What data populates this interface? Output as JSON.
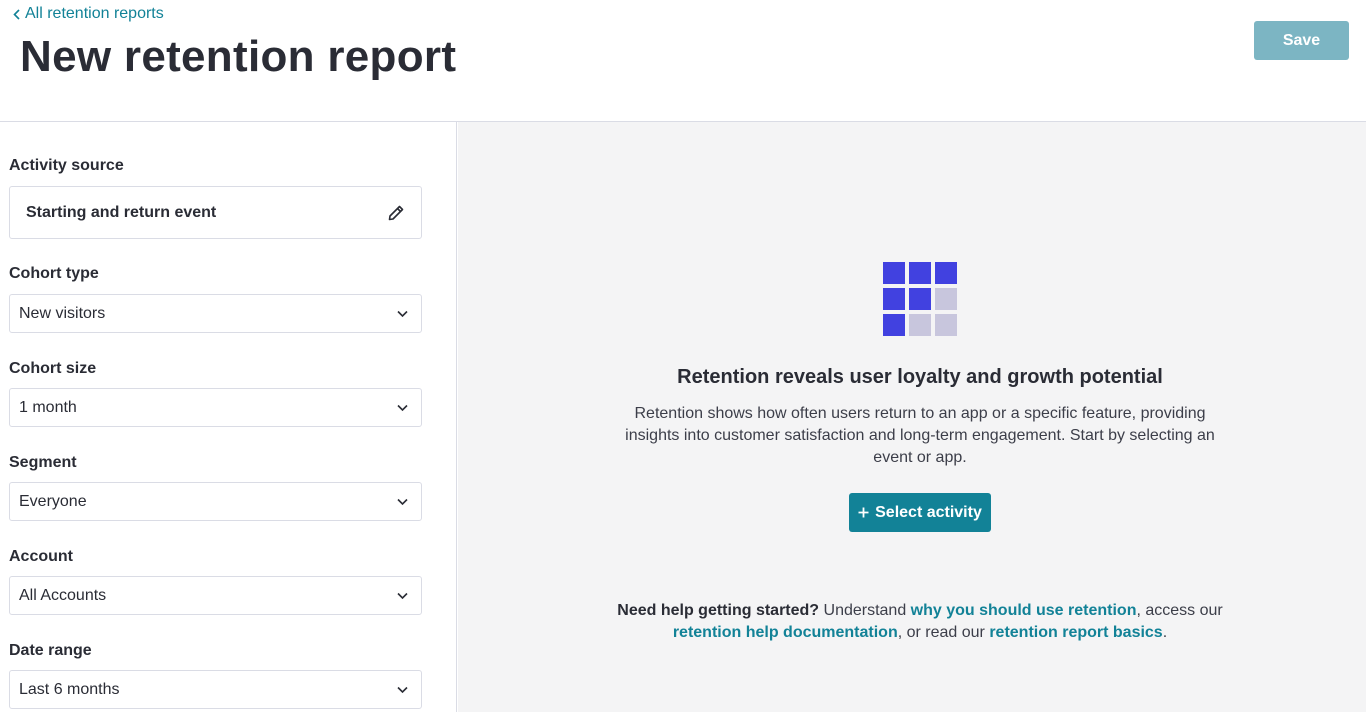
{
  "header": {
    "back_link": "All retention reports",
    "title": "New retention report",
    "save_label": "Save"
  },
  "sidebar": {
    "activity_source": {
      "label": "Activity source",
      "value": "Starting and return event"
    },
    "cohort_type": {
      "label": "Cohort type",
      "value": "New visitors"
    },
    "cohort_size": {
      "label": "Cohort size",
      "value": "1 month"
    },
    "segment": {
      "label": "Segment",
      "value": "Everyone"
    },
    "account": {
      "label": "Account",
      "value": "All Accounts"
    },
    "date_range": {
      "label": "Date range",
      "value": "Last 6 months"
    }
  },
  "main": {
    "empty_title": "Retention reveals user loyalty and growth potential",
    "empty_description": "Retention shows how often users return to an app or a specific feature, providing insights into customer satisfaction and long-term engagement. Start by selecting an event or app.",
    "select_activity_label": "Select activity",
    "help": {
      "lead": "Need help getting started?",
      "text1": " Understand ",
      "link1": "why you should use retention",
      "text2": ", access our ",
      "link2": "retention help documentation",
      "text3": ", or read our ",
      "link3": "retention report basics",
      "text4": "."
    }
  },
  "colors": {
    "accent": "#128297",
    "save_disabled": "#7cb5c3",
    "grid_active": "#4141e0",
    "grid_inactive": "#c8c6dd"
  },
  "icons": [
    "chevron-left-icon",
    "pencil-icon",
    "chevron-down-icon",
    "plus-icon",
    "retention-grid-icon"
  ]
}
